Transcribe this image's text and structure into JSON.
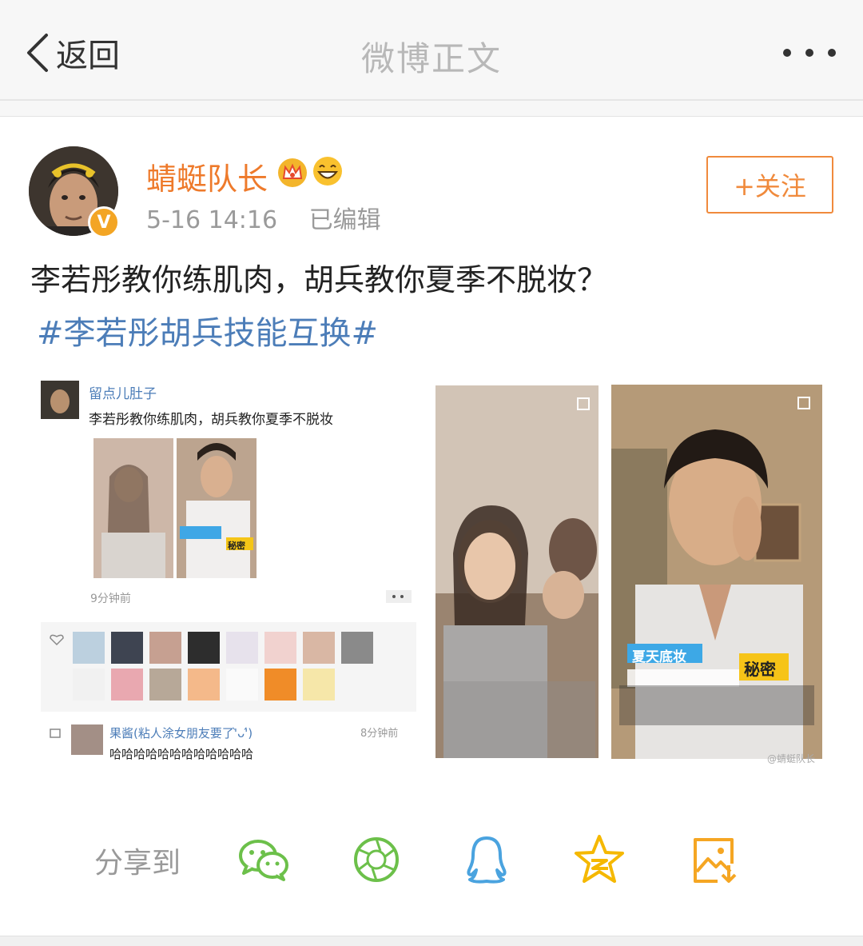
{
  "nav": {
    "back_label": "返回",
    "title": "微博正文"
  },
  "author": {
    "name": "蜻蜓队长",
    "verified_mark": "V",
    "time": "5-16 14:16",
    "edit_status": "已编辑"
  },
  "follow_label": "+关注",
  "post": {
    "text": "李若彤教你练肌肉，胡兵教你夏季不脱妆？",
    "hashtag": "#李若彤胡兵技能互换#"
  },
  "embedded_post": {
    "user": "留点儿肚子",
    "text": "李若彤教你练肌肉，胡兵教你夏季不脱妆",
    "time": "9分钟前",
    "thumb_caption": "秘密",
    "comment_user": "果酱(粘人涂女朋友要了'̀ᴗ'́)",
    "comment_time": "8分钟前",
    "comment_text": "哈哈哈哈哈哈哈哈哈哈哈哈"
  },
  "video_right": {
    "caption_title": "夏天底妆",
    "caption_secret": "秘密",
    "watermark": "@蜻蜓队长"
  },
  "share": {
    "label": "分享到",
    "targets": [
      "wechat-icon",
      "moments-icon",
      "qq-icon",
      "qzone-icon",
      "save-image-icon"
    ]
  },
  "colors": {
    "accent_orange": "#ee7a2b",
    "link_blue": "#4c7db8",
    "icon_green": "#6cc04a",
    "icon_blue": "#4aa3df",
    "icon_yellow": "#f5b800"
  }
}
